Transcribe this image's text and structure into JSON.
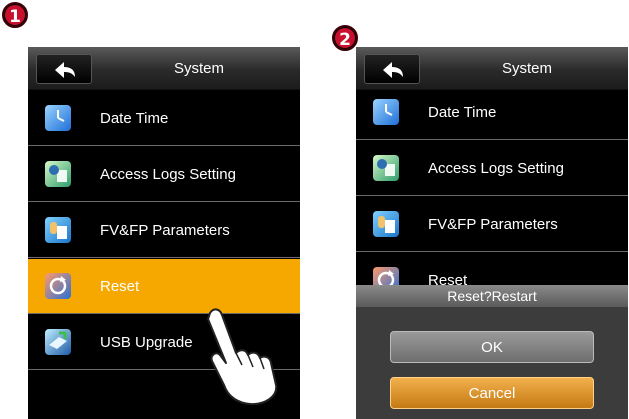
{
  "steps": [
    "1",
    "2"
  ],
  "screen1": {
    "title": "System",
    "menu": [
      {
        "label": "Date Time",
        "icon": "clock-icon"
      },
      {
        "label": "Access Logs Setting",
        "icon": "logs-icon"
      },
      {
        "label": "FV&FP Parameters",
        "icon": "parameters-icon"
      },
      {
        "label": "Reset",
        "icon": "reset-icon",
        "selected": true
      },
      {
        "label": "USB Upgrade",
        "icon": "usb-upgrade-icon"
      }
    ]
  },
  "screen2": {
    "title": "System",
    "menu": [
      {
        "label": "Date Time",
        "icon": "clock-icon"
      },
      {
        "label": "Access Logs Setting",
        "icon": "logs-icon"
      },
      {
        "label": "FV&FP Parameters",
        "icon": "parameters-icon"
      },
      {
        "label": "Reset",
        "icon": "reset-icon"
      }
    ],
    "dialog": {
      "title": "Reset?Restart",
      "ok_label": "OK",
      "cancel_label": "Cancel"
    }
  },
  "colors": {
    "selected": "#f7a800",
    "badge": "#c8102e",
    "cancel": "#e09a2c"
  }
}
